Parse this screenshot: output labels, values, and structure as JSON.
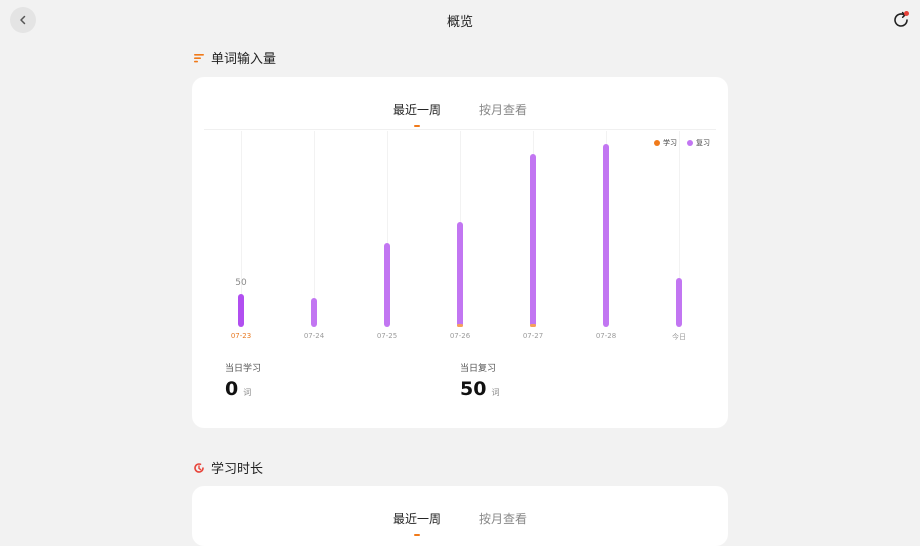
{
  "header": {
    "title": "概览"
  },
  "section1": {
    "title": "单词输入量",
    "tabs": [
      "最近一周",
      "按月查看"
    ],
    "legend": [
      {
        "label": "学习",
        "color": "#f07a1a"
      },
      {
        "label": "复习",
        "color": "#c276f2"
      }
    ],
    "stats": [
      {
        "label": "当日学习",
        "value": "0",
        "unit": "词"
      },
      {
        "label": "当日复习",
        "value": "50",
        "unit": "词"
      }
    ]
  },
  "chart_data": {
    "type": "bar",
    "categories": [
      "07-23",
      "07-24",
      "07-25",
      "07-26",
      "07-27",
      "07-28",
      "今日"
    ],
    "series": [
      {
        "name": "学习",
        "values": [
          0,
          0,
          0,
          4,
          4,
          0,
          0
        ]
      },
      {
        "name": "复习",
        "values": [
          50,
          44,
          128,
          160,
          265,
          280,
          75
        ]
      }
    ],
    "highlight_category": "07-23",
    "highlight_label": "50",
    "colors": {
      "learn": "#f5a05c",
      "review": "#c276f2",
      "review_highlight": "#b14ff0"
    },
    "ylim": [
      0,
      300
    ]
  },
  "section2": {
    "title": "学习时长",
    "tabs": [
      "最近一周",
      "按月查看"
    ]
  }
}
